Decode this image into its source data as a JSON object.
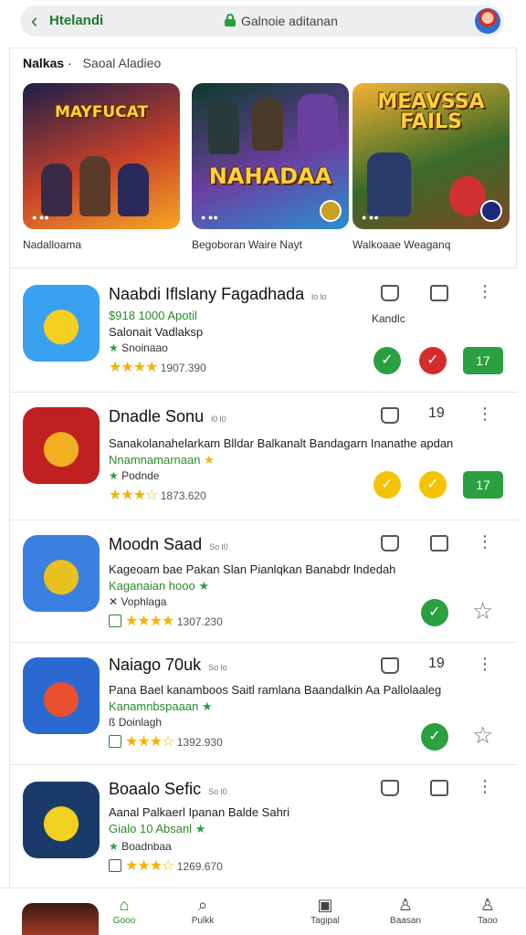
{
  "browser": {
    "site": "Htelandi",
    "url": "Galnoie aditanan"
  },
  "featured": {
    "title": "Nalkas",
    "subtitle": "Saoal  Aladieo",
    "banners": [
      {
        "title": "MAYFUCAT",
        "label": "Nadalloama",
        "colors": [
          "#1b1f4a",
          "#c8402a",
          "#f5a623"
        ]
      },
      {
        "title": "NAHADAA",
        "label": "Begoboran  Waire Nayt",
        "colors": [
          "#0d3a2a",
          "#6a3fa0",
          "#2a8fd0"
        ]
      },
      {
        "title": "MEAVSSA\nFAILS",
        "label": "Walkoaae Weaganq",
        "colors": [
          "#f2b233",
          "#3a6a2a",
          "#7a4a22"
        ]
      }
    ]
  },
  "apps": [
    {
      "name": "Naabdi Iflslany Fagadhada",
      "tag": "lo lo",
      "line1": "$918 1000 Apotil",
      "line2": "Salonait Vadlaksp",
      "category": "Snoinaao",
      "rating_text": "1907.390",
      "rating": 4.0,
      "action_label": "Kandlc",
      "pill": "17",
      "icon_colors": [
        "#3aa0f0",
        "#f5d020"
      ]
    },
    {
      "name": "Dnadle Sonu",
      "tag": "l0 l0",
      "count": "19",
      "line1": "Sanakolanahelarkam Blldar Balkanalt Bandagarn Inanathe apdan",
      "line2": "Nnamnamarnaan",
      "category": "Podnde",
      "rating_text": "1873.620",
      "rating": 3.0,
      "pill": "17",
      "icon_colors": [
        "#c02020",
        "#f0b020"
      ]
    },
    {
      "name": "Moodn Saad",
      "tag": "So l0",
      "line1": "Kageoam bae Pakan Slan Pianlqkan Banabdr lndedah",
      "line2": "Kaganaian hooo",
      "category": "Vophlaga",
      "rating_text": "1307.230",
      "rating": 4.0,
      "icon_colors": [
        "#3a80e0",
        "#e8c020"
      ]
    },
    {
      "name": "Naiago 70uk",
      "tag": "So lo",
      "count": "19",
      "line1": "Pana Bael kanamboos Saitl ramlana Baandalkin Aa Pallolaaleg",
      "line2": "Kanamnbspaaan",
      "category": "Doinlagh",
      "rating_text": "1392.930",
      "rating": 3.0,
      "icon_colors": [
        "#2a6ad0",
        "#e85030"
      ]
    },
    {
      "name": "Boaalo Sefic",
      "tag": "So l0",
      "line1": "Aanal Palkaerl Ipanan Balde Sahri",
      "line2": "Gialo 10 Absanl",
      "category": "Boadnbaa",
      "rating_text": "1269.670",
      "rating": 2.5,
      "icon_colors": [
        "#1a3a6a",
        "#f0d020"
      ]
    }
  ],
  "nav": {
    "items": [
      "Gooo",
      "Pulkk",
      "Tagipal",
      "Baasan",
      "Taoo"
    ]
  }
}
